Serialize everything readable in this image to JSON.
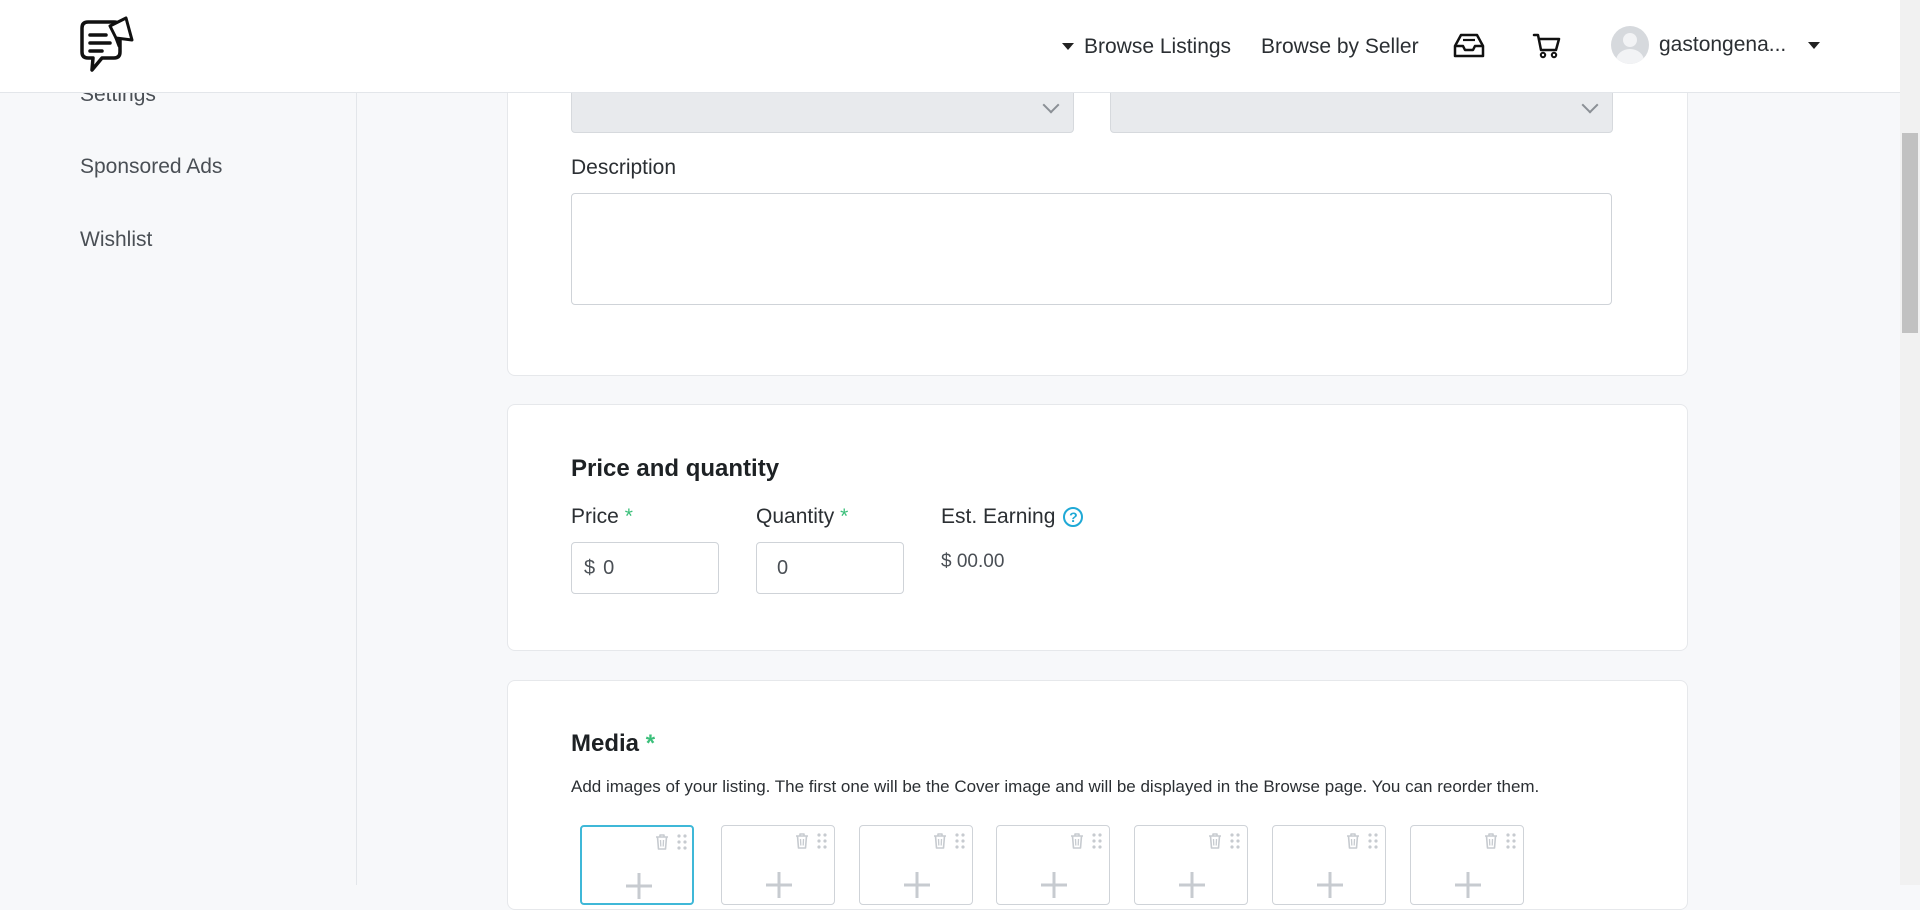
{
  "header": {
    "nav_browse": "Browse Listings",
    "nav_seller": "Browse by Seller",
    "username": "gastongena..."
  },
  "sidebar": {
    "items": [
      {
        "label": "Settings"
      },
      {
        "label": "Sponsored Ads"
      },
      {
        "label": "Wishlist"
      }
    ]
  },
  "details": {
    "description_label": "Description",
    "description_value": ""
  },
  "pricing": {
    "title": "Price and quantity",
    "price_label": "Price",
    "price_currency": "$",
    "price_value": "0",
    "quantity_label": "Quantity",
    "quantity_value": "0",
    "earning_label": "Est. Earning",
    "earning_value": "$ 00.00",
    "required_mark": "*"
  },
  "media": {
    "title": "Media",
    "required_mark": "*",
    "description": "Add images of your listing. The first one will be the Cover image and will be displayed in the Browse page. You can reorder them."
  },
  "colors": {
    "accent": "#3fb8d8",
    "required": "#3bbf7a",
    "help": "#1fa9d6"
  }
}
